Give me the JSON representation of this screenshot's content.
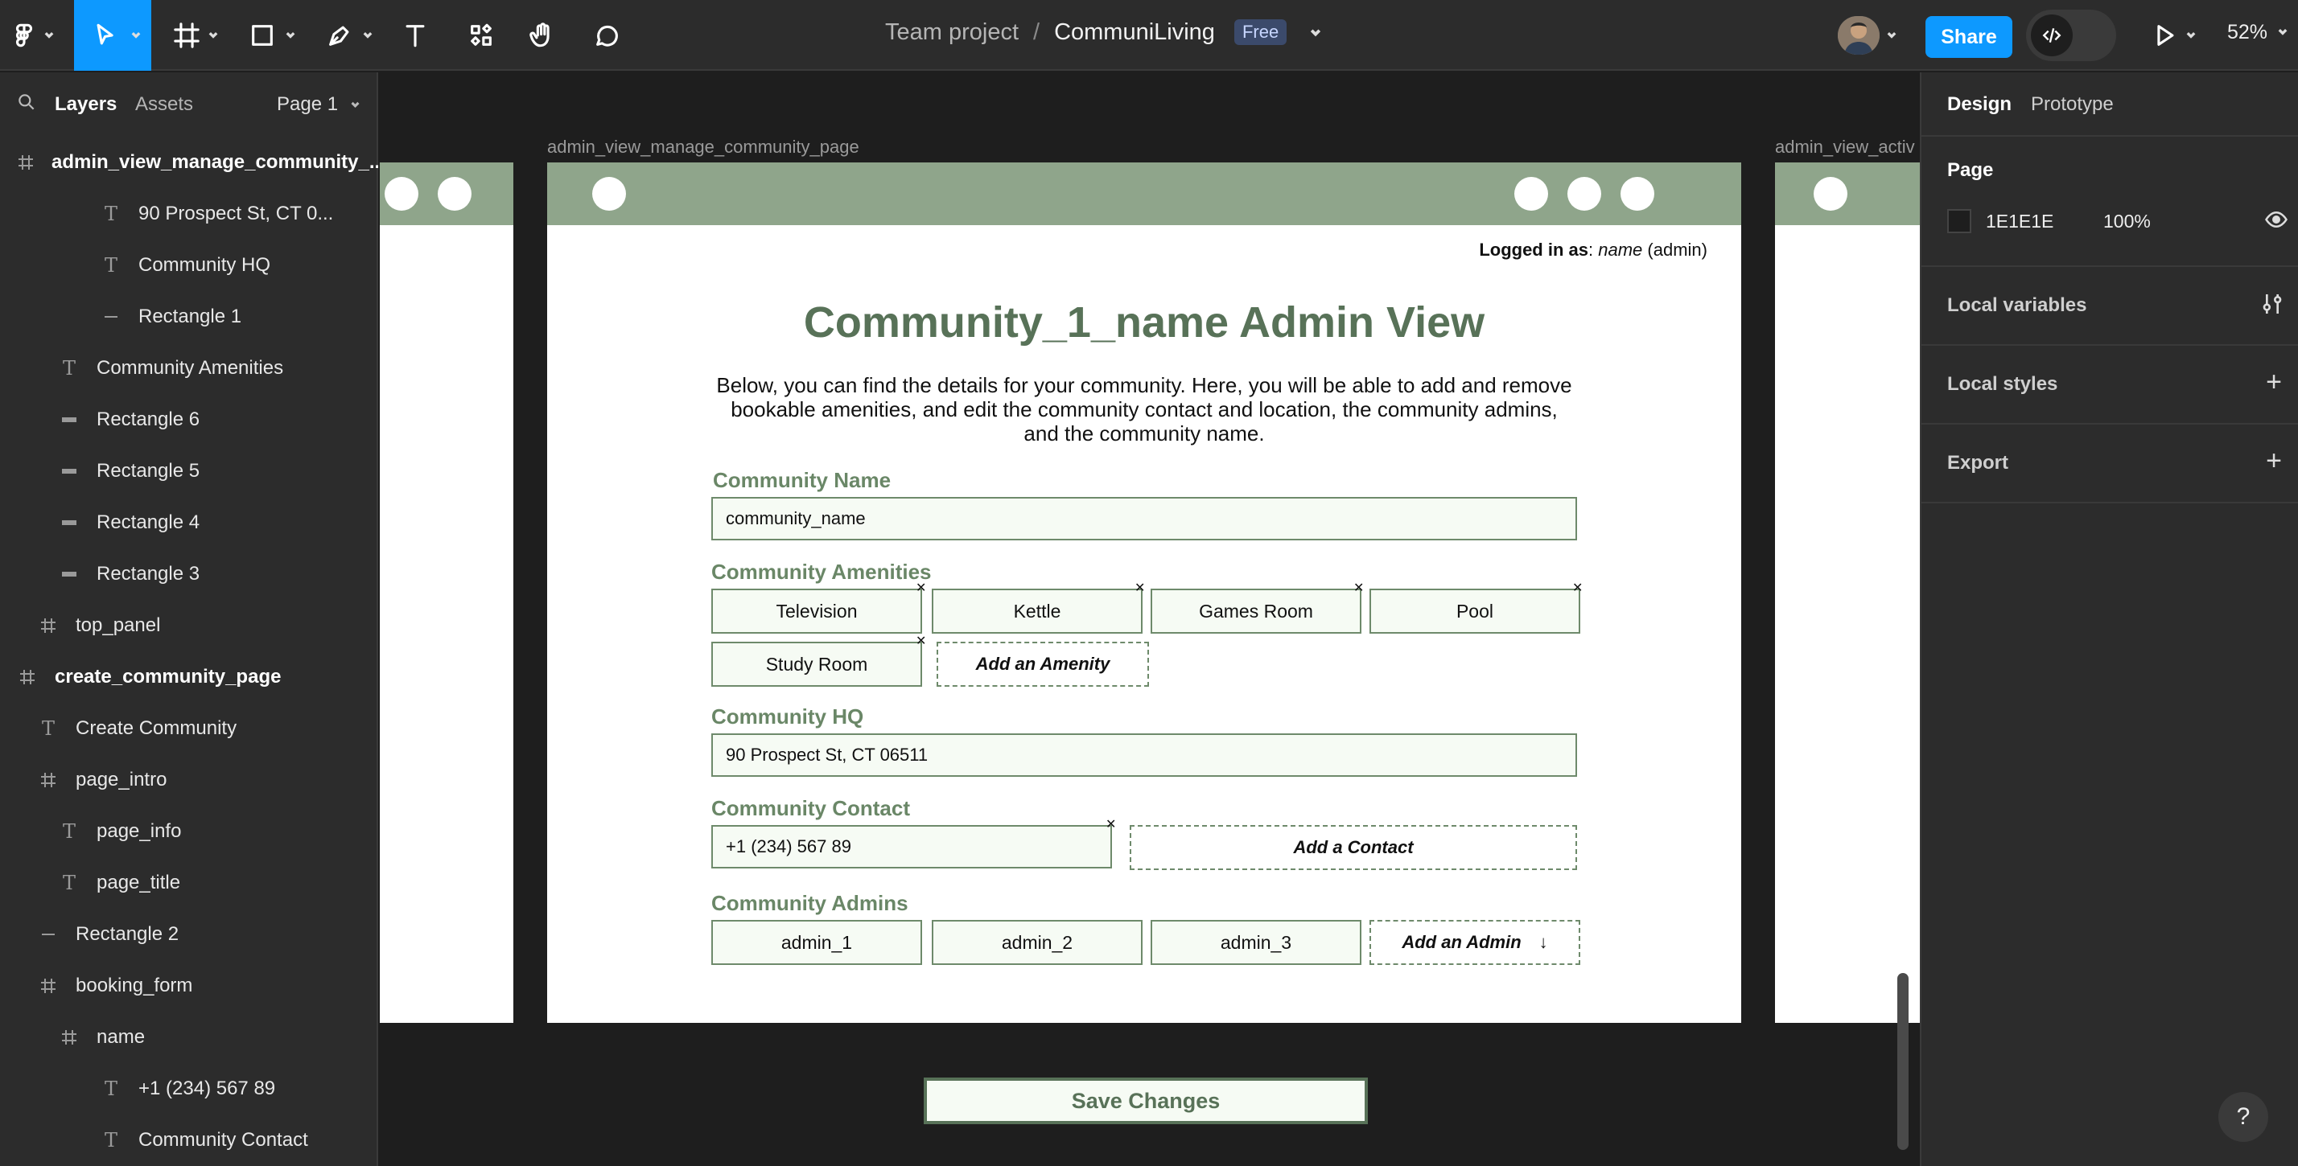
{
  "topbar": {
    "team": "Team project",
    "separator": "/",
    "project": "CommuniLiving",
    "plan_badge": "Free",
    "share_label": "Share",
    "zoom_label": "52%"
  },
  "left_panel": {
    "tabs": {
      "layers": "Layers",
      "assets": "Assets",
      "page": "Page 1"
    },
    "layers": [
      {
        "label": "admin_view_manage_community_...",
        "icon": "frame",
        "bold": true
      },
      {
        "label": "90 Prospect St, CT 0...",
        "icon": "text"
      },
      {
        "label": "Community HQ",
        "icon": "text"
      },
      {
        "label": "Rectangle 1",
        "icon": "line"
      },
      {
        "label": "Community Amenities",
        "icon": "text"
      },
      {
        "label": "Rectangle 6",
        "icon": "rect"
      },
      {
        "label": "Rectangle 5",
        "icon": "rect"
      },
      {
        "label": "Rectangle 4",
        "icon": "rect"
      },
      {
        "label": "Rectangle 3",
        "icon": "rect"
      },
      {
        "label": "top_panel",
        "icon": "frame"
      },
      {
        "label": "create_community_page",
        "icon": "frame",
        "bold": true
      },
      {
        "label": "Create Community",
        "icon": "text"
      },
      {
        "label": "page_intro",
        "icon": "frame"
      },
      {
        "label": "page_info",
        "icon": "text"
      },
      {
        "label": "page_title",
        "icon": "text"
      },
      {
        "label": "Rectangle 2",
        "icon": "line"
      },
      {
        "label": "booking_form",
        "icon": "frame"
      },
      {
        "label": "name",
        "icon": "frame"
      },
      {
        "label": "+1 (234) 567 89",
        "icon": "text"
      },
      {
        "label": "Community Contact",
        "icon": "text"
      }
    ]
  },
  "right_panel": {
    "tabs": {
      "design": "Design",
      "prototype": "Prototype"
    },
    "page_section": "Page",
    "page_color": "1E1E1E",
    "page_opacity": "100%",
    "local_variables": "Local variables",
    "local_styles": "Local styles",
    "export": "Export",
    "help": "?"
  },
  "canvas": {
    "frame_labels": {
      "main": "admin_view_manage_community_page",
      "right": "admin_view_activ"
    },
    "page": {
      "logged_in_prefix": "Logged in as",
      "logged_in_colon": ":",
      "logged_in_name": "name",
      "logged_in_role": "(admin)",
      "title": "Community_1_name Admin View",
      "intro": "Below, you can find the details for your community. Here, you will be able to add and remove bookable amenities, and edit the community contact and location, the community admins, and the community name.",
      "name_label": "Community Name",
      "name_value": "community_name",
      "amenities_label": "Community Amenities",
      "amenities": [
        "Television",
        "Kettle",
        "Games Room",
        "Pool",
        "Study Room"
      ],
      "add_amenity": "Add an Amenity",
      "hq_label": "Community HQ",
      "hq_value": "90 Prospect St, CT 06511",
      "contact_label": "Community Contact",
      "contact_value": "+1 (234) 567 89",
      "add_contact": "Add a Contact",
      "admins_label": "Community Admins",
      "admins": [
        "admin_1",
        "admin_2",
        "admin_3"
      ],
      "add_admin": "Add an Admin",
      "save": "Save Changes"
    }
  },
  "colors": {
    "accent": "#0d99ff",
    "header_green": "#8fa58b",
    "title_green": "#587258",
    "label_green": "#6a8767",
    "canvas_bg": "#1e1e1e"
  }
}
